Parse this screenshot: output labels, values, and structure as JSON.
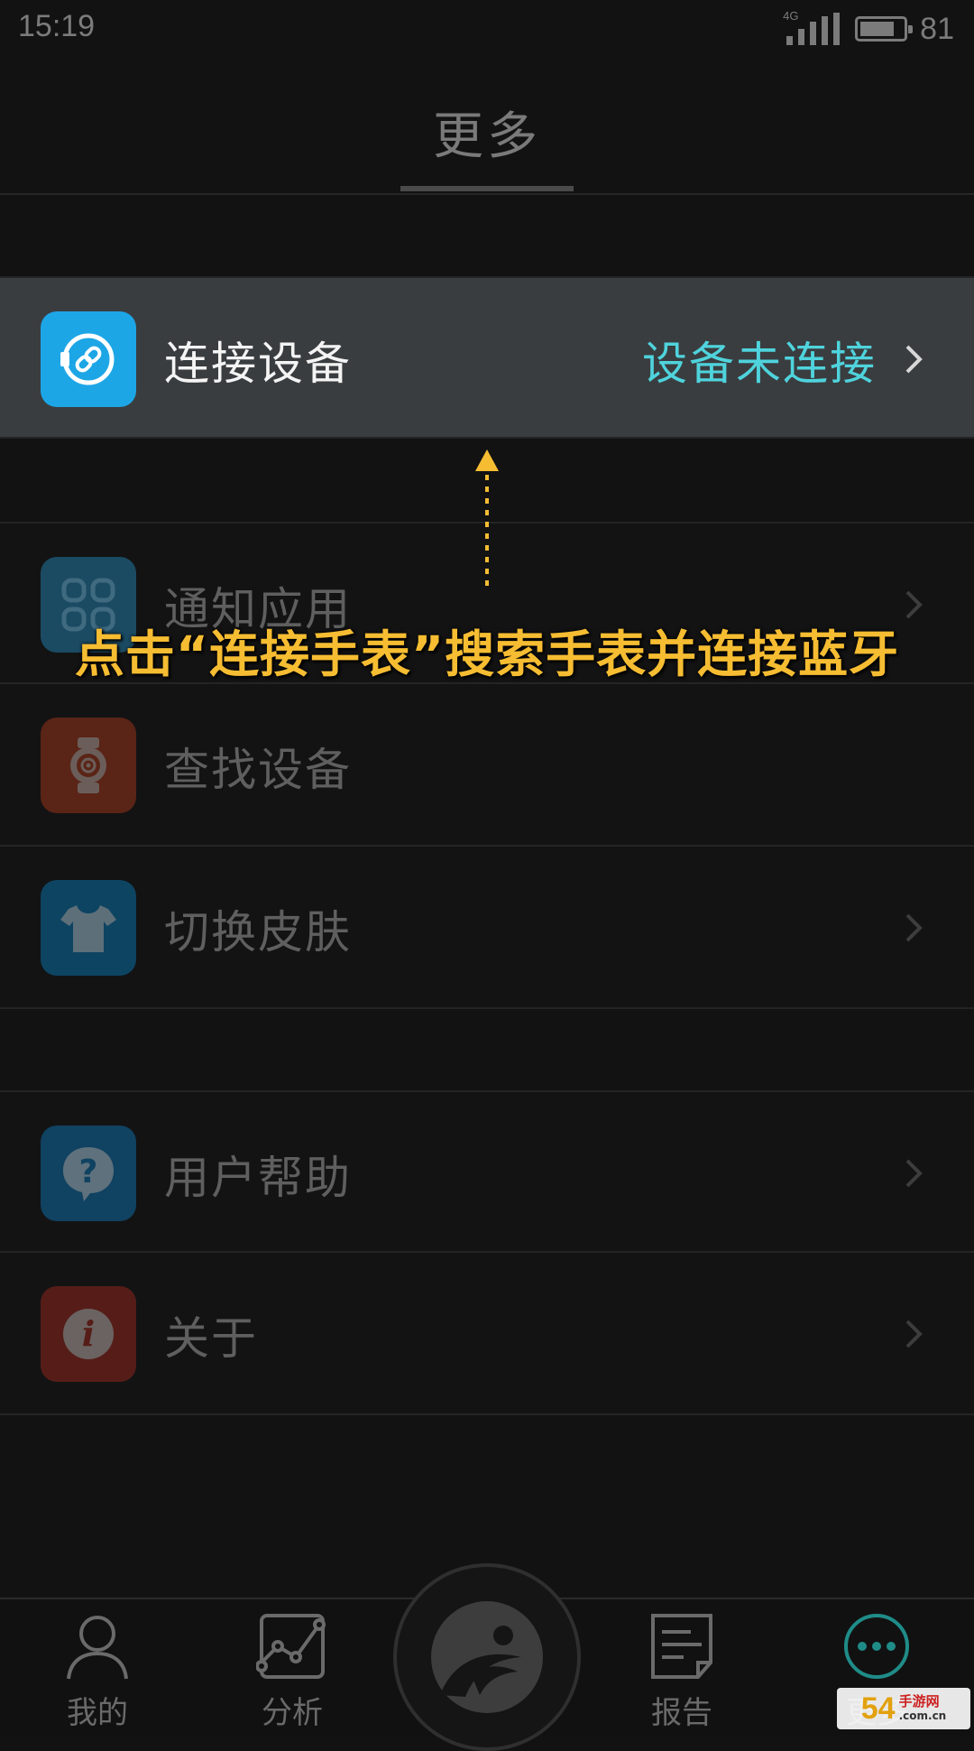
{
  "status_bar": {
    "time": "15:19",
    "network": "4G",
    "battery_percent": "81",
    "battery_level": 0.81
  },
  "header": {
    "title": "更多"
  },
  "menu": {
    "connect_device": {
      "label": "连接设备",
      "status": "设备未连接",
      "icon": "watch-link-icon",
      "color": "#1da6e6"
    },
    "notify_apps": {
      "label": "通知应用",
      "icon": "grid-apps-icon",
      "color": "#1b4b63"
    },
    "find_device": {
      "label": "查找设备",
      "icon": "watch-icon",
      "color": "#5a2416"
    },
    "switch_skin": {
      "label": "切换皮肤",
      "icon": "tshirt-icon",
      "color": "#0d4462"
    },
    "user_help": {
      "label": "用户帮助",
      "icon": "question-icon",
      "color": "#104261"
    },
    "about": {
      "label": "关于",
      "icon": "info-icon",
      "color": "#561d18"
    }
  },
  "annotation": {
    "text": "点击“连接手表”搜索手表并连接蓝牙",
    "color": "#f6bd32"
  },
  "bottom_nav": {
    "items": [
      {
        "label": "我的",
        "icon": "person-icon"
      },
      {
        "label": "分析",
        "icon": "chart-icon"
      },
      {
        "label": "",
        "icon": "runner-logo-icon"
      },
      {
        "label": "报告",
        "icon": "report-icon"
      },
      {
        "label": "更多",
        "icon": "more-icon"
      }
    ]
  },
  "watermark": {
    "brand": "54",
    "text": "手游网",
    "domain": ".com.cn"
  }
}
